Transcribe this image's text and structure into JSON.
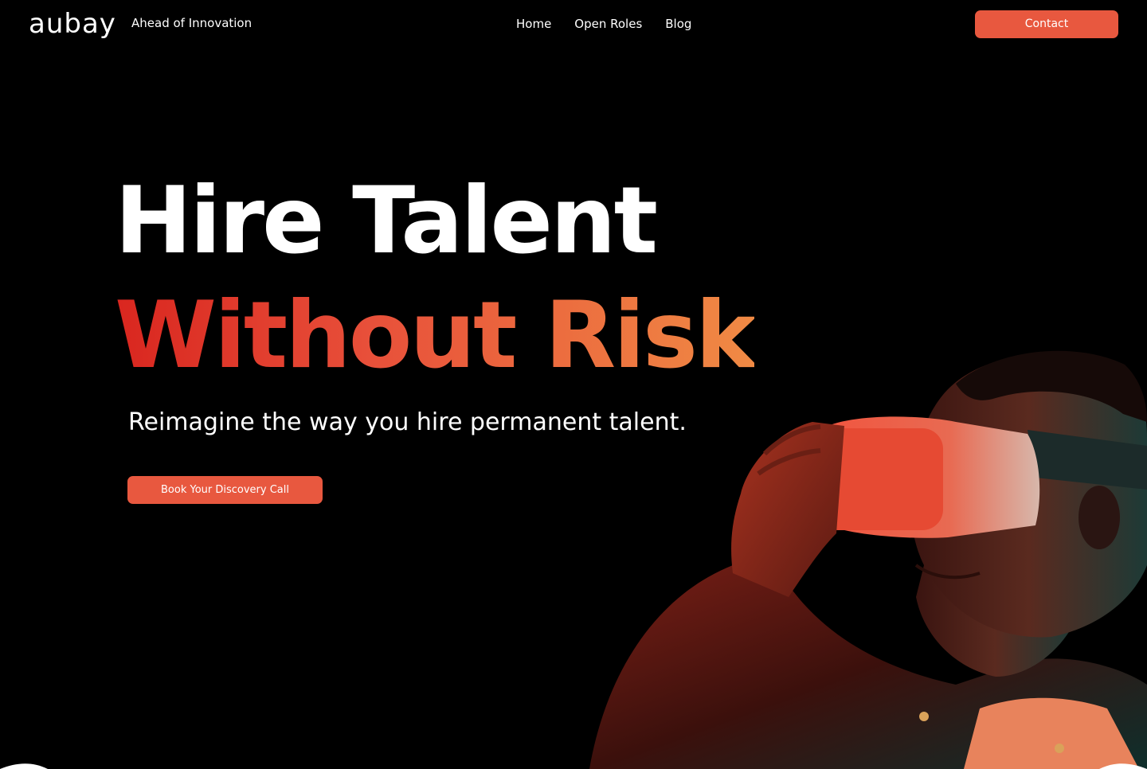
{
  "header": {
    "logo_text": "aubay",
    "tagline": "Ahead of Innovation",
    "nav": [
      "Home",
      "Open Roles",
      "Blog"
    ],
    "contact_label": "Contact"
  },
  "hero": {
    "headline_line1": "Hire Talent",
    "headline_line2": "Without Risk",
    "subheadline": "Reimagine the way you hire permanent talent.",
    "cta_label": "Book Your Discovery Call"
  },
  "colors": {
    "background": "#000000",
    "accent": "#e8583f",
    "gradient_start": "#d9261f",
    "gradient_end": "#f08a44",
    "text": "#ffffff"
  }
}
